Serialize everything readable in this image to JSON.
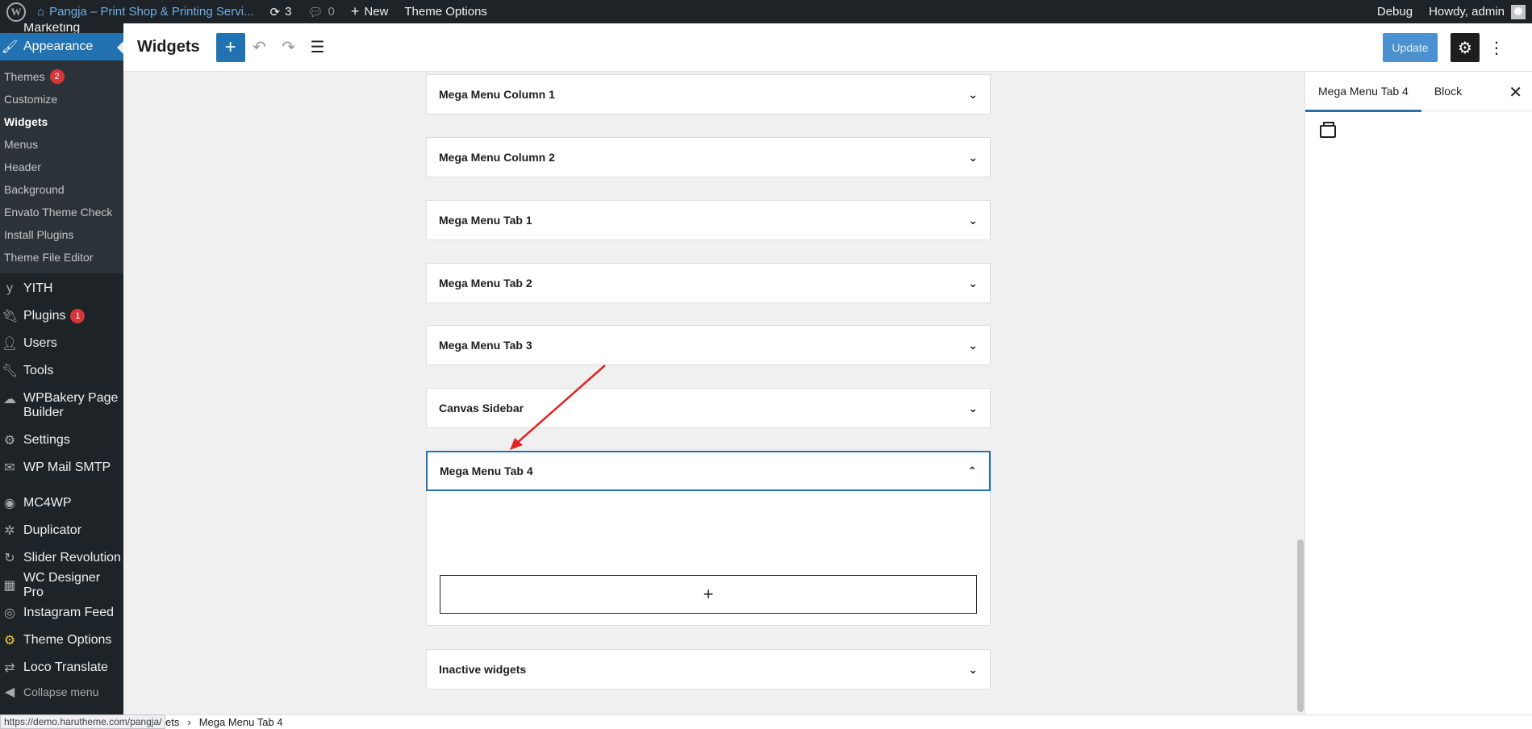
{
  "admin_bar": {
    "site_name": "Pangja – Print Shop & Printing Servi...",
    "updates_count": "3",
    "comments_count": "0",
    "new_label": "New",
    "theme_options_label": "Theme Options",
    "debug_label": "Debug",
    "howdy_label": "Howdy, admin"
  },
  "sidebar": {
    "partial_top_label": "Marketing",
    "appearance_label": "Appearance",
    "submenu": [
      {
        "label": "Themes",
        "badge": "2"
      },
      {
        "label": "Customize"
      },
      {
        "label": "Widgets",
        "active": true
      },
      {
        "label": "Menus"
      },
      {
        "label": "Header"
      },
      {
        "label": "Background"
      },
      {
        "label": "Envato Theme Check"
      },
      {
        "label": "Install Plugins"
      },
      {
        "label": "Theme File Editor"
      }
    ],
    "items": [
      {
        "label": "YITH",
        "icon": "yith-icon"
      },
      {
        "label": "Plugins",
        "icon": "plugin-icon",
        "badge": "1"
      },
      {
        "label": "Users",
        "icon": "users-icon"
      },
      {
        "label": "Tools",
        "icon": "wrench-icon"
      },
      {
        "label": "WPBakery Page",
        "label2": "Builder",
        "icon": "wpbakery-icon"
      },
      {
        "label": "Settings",
        "icon": "settings-icon"
      },
      {
        "label": "WP Mail SMTP",
        "icon": "mail-icon"
      },
      {
        "label": "MC4WP",
        "icon": "mc4wp-icon"
      },
      {
        "label": "Duplicator",
        "icon": "duplicator-icon"
      },
      {
        "label": "Slider Revolution",
        "icon": "slider-icon"
      },
      {
        "label": "WC Designer Pro",
        "icon": "designer-icon"
      },
      {
        "label": "Instagram Feed",
        "icon": "instagram-icon"
      },
      {
        "label": "Theme Options",
        "icon": "gear-icon"
      },
      {
        "label": "Loco Translate",
        "icon": "translate-icon"
      }
    ],
    "collapse_label": "Collapse menu"
  },
  "header": {
    "title": "Widgets",
    "update_label": "Update"
  },
  "widget_areas": [
    {
      "label": "Mega Menu Column 1"
    },
    {
      "label": "Mega Menu Column 2"
    },
    {
      "label": "Mega Menu Tab 1"
    },
    {
      "label": "Mega Menu Tab 2"
    },
    {
      "label": "Mega Menu Tab 3"
    },
    {
      "label": "Canvas Sidebar"
    },
    {
      "label": "Mega Menu Tab 4",
      "open": true
    },
    {
      "label": "Inactive widgets"
    }
  ],
  "inspector": {
    "tab_area": "Mega Menu Tab 4",
    "tab_block": "Block"
  },
  "footer": {
    "status_url": "https://demo.harutheme.com/pangja/",
    "crumb_partial": "ets",
    "crumb_current": "Mega Menu Tab 4"
  },
  "colors": {
    "accent": "#2271b1",
    "admin_dark": "#1d2327",
    "annotation_arrow": "#e02424"
  }
}
